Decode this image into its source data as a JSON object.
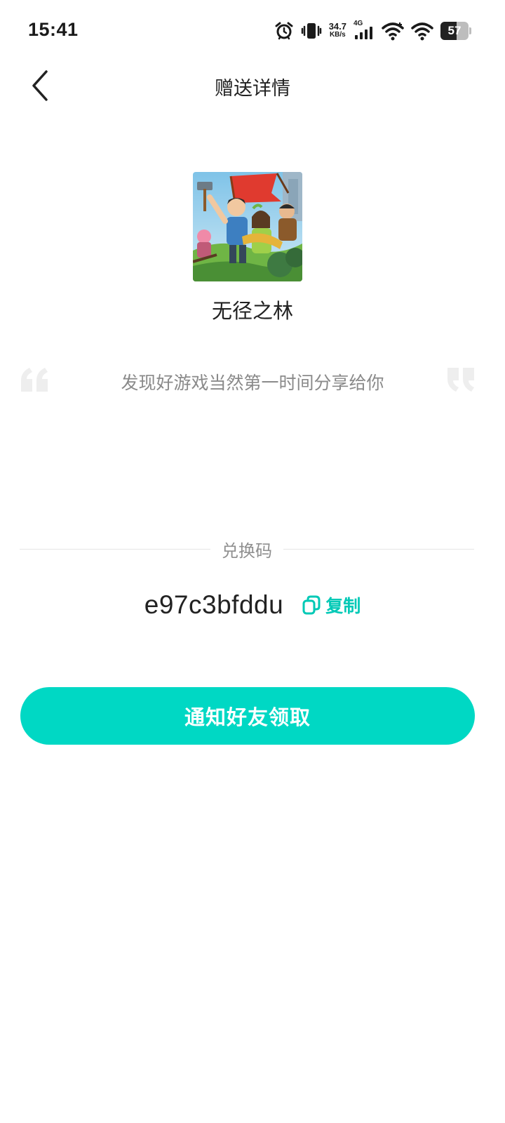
{
  "status_bar": {
    "time": "15:41",
    "net_speed_value": "34.7",
    "net_speed_unit": "KB/s",
    "network_type": "4G",
    "battery_level": "57"
  },
  "header": {
    "title": "赠送详情",
    "back_icon": "chevron-left-icon"
  },
  "game": {
    "name": "无径之林",
    "cover_icon": "game-cover-image"
  },
  "quote": {
    "text": "发现好游戏当然第一时间分享给你"
  },
  "redeem": {
    "label": "兑换码",
    "code": "e97c3bfddu",
    "copy_label": "复制",
    "copy_icon": "copy-icon"
  },
  "actions": {
    "notify_label": "通知好友领取"
  },
  "colors": {
    "accent": "#00d8c4",
    "accent_text": "#00c9b6",
    "quote_mark": "#eeeeee"
  }
}
